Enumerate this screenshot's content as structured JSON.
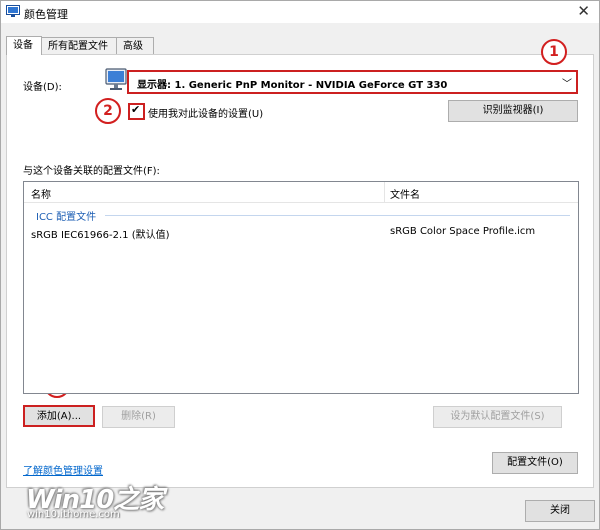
{
  "window": {
    "title": "颜色管理",
    "close_glyph": "✕"
  },
  "tabs": [
    {
      "label": "设备"
    },
    {
      "label": "所有配置文件"
    },
    {
      "label": "高级"
    }
  ],
  "device": {
    "label": "设备(D):",
    "selected": "显示器: 1. Generic PnP Monitor - NVIDIA GeForce GT 330",
    "use_my_settings_label": "使用我对此设备的设置(U)",
    "use_my_settings_checked": true,
    "identify_button": "识别监视器(I)"
  },
  "profiles": {
    "section_label": "与这个设备关联的配置文件(F):",
    "columns": [
      "名称",
      "文件名"
    ],
    "group_label": "ICC 配置文件",
    "rows": [
      {
        "name": "sRGB IEC61966-2.1 (默认值)",
        "file": "sRGB Color Space Profile.icm"
      }
    ]
  },
  "actions": {
    "add": "添加(A)...",
    "remove": "删除(R)",
    "set_default": "设为默认配置文件(S)"
  },
  "footer": {
    "learn_link": "了解颜色管理设置",
    "profiles_button": "配置文件(O)",
    "close_button": "关闭"
  },
  "annotations": {
    "one": "1",
    "two": "2",
    "three": "3"
  },
  "watermark": {
    "logo": "Win10之家",
    "url": "win10.ithome.com"
  },
  "colors": {
    "annotation_red": "#cc2020",
    "link_blue": "#0066cc",
    "group_blue": "#1e5fb4"
  }
}
